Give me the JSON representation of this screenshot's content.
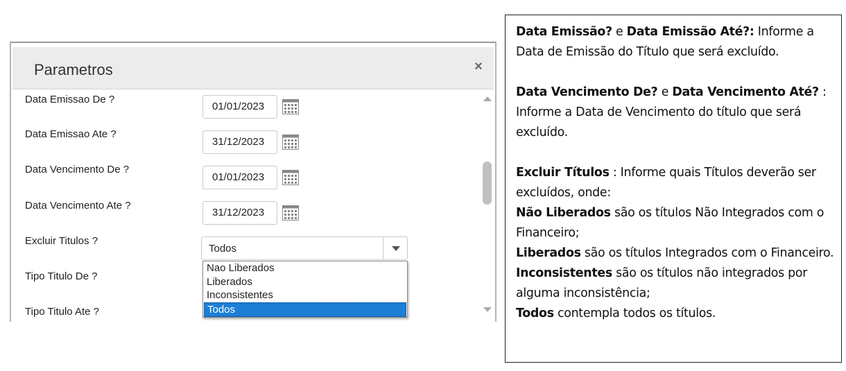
{
  "dialog": {
    "title": "Parametros",
    "close_symbol": "×",
    "fields": [
      {
        "label": "Data Emissao De ?",
        "value": "01/01/2023"
      },
      {
        "label": "Data Emissao Ate ?",
        "value": "31/12/2023"
      },
      {
        "label": "Data Vencimento De ?",
        "value": "01/01/2023"
      },
      {
        "label": "Data Vencimento Ate ?",
        "value": "31/12/2023"
      }
    ],
    "excluir": {
      "label": "Excluir Titulos ?",
      "value": "Todos"
    },
    "tipo_de": {
      "label": "Tipo Titulo De ?"
    },
    "tipo_ate": {
      "label": "Tipo Titulo Ate ?"
    },
    "dropdown_options": [
      "Nao Liberados",
      "Liberados",
      "Inconsistentes",
      "Todos"
    ],
    "dropdown_selected": "Todos"
  },
  "help": {
    "p1": {
      "b1": "Data Emissão?",
      "t1": " e ",
      "b2": "Data Emissão Até?:",
      "t2": " Informe a Data de Emissão do Título que será excluído."
    },
    "p2": {
      "b1": "Data Vencimento De?",
      "t1": " e ",
      "b2": "Data Vencimento Até?",
      "t2": " : Informe a Data de Vencimento do título que será excluído."
    },
    "p3": {
      "b1": "Excluir Títulos",
      "t1": " : Informe quais Títulos deverão ser excluídos, onde:"
    },
    "p4": {
      "b1": "Não Liberados",
      "t1": " são os títulos Não Integrados com o Financeiro;"
    },
    "p5": {
      "b1": "Liberados",
      "t1": " são os títulos Integrados com o Financeiro."
    },
    "p6": {
      "b1": "Inconsistentes",
      "t1": " são os títulos não integrados por alguma inconsistência;"
    },
    "p7": {
      "b1": "Todos",
      "t1": " contempla todos os títulos."
    }
  },
  "icons": {
    "calendar": "calendar-icon",
    "close": "close-icon",
    "dropdown": "chevron-down-icon"
  },
  "colors": {
    "selected_option": "#1c7ed6",
    "header_bg": "#ececec"
  }
}
